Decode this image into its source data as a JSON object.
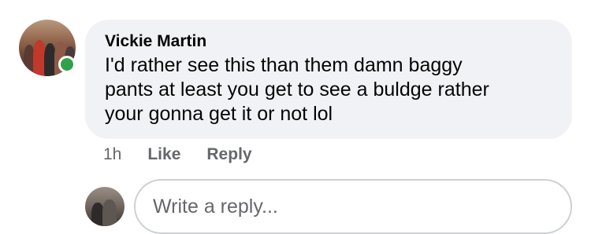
{
  "comment": {
    "author": "Vickie Martin",
    "text": "I'd rather see this than them damn baggy\npants at least you get to see a buldge rather\nyour gonna get it or not lol",
    "online": true
  },
  "actions": {
    "time": "1h",
    "like": "Like",
    "reply": "Reply"
  },
  "reply_box": {
    "placeholder": "Write a reply..."
  },
  "colors": {
    "bubble": "#f0f2f5",
    "online": "#31a24c",
    "meta_text": "#65676b"
  }
}
